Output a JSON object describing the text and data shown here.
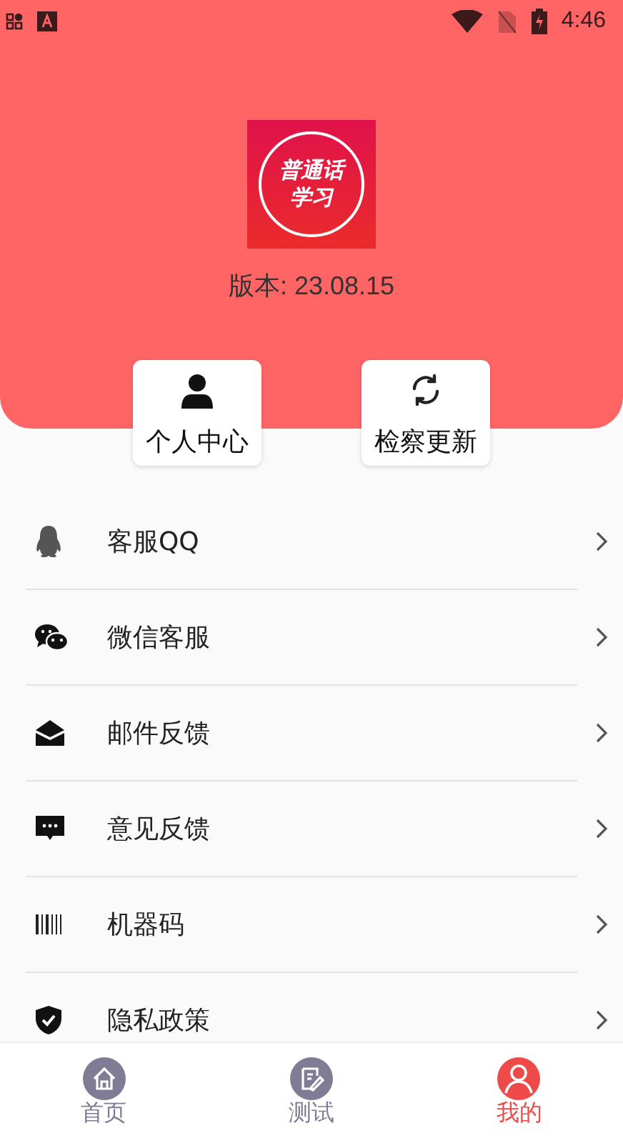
{
  "status_bar": {
    "time": "4:46"
  },
  "header": {
    "logo_text": [
      "普通话",
      "学习"
    ],
    "version": "版本: 23.08.15"
  },
  "actions": [
    {
      "kind": "person",
      "label": "个人中心"
    },
    {
      "kind": "refresh",
      "label": "检察更新"
    }
  ],
  "menu": [
    {
      "kind": "qq",
      "label": "客服QQ"
    },
    {
      "kind": "wechat",
      "label": "微信客服"
    },
    {
      "kind": "mail",
      "label": "邮件反馈"
    },
    {
      "kind": "message",
      "label": "意见反馈"
    },
    {
      "kind": "barcode",
      "label": "机器码"
    },
    {
      "kind": "shield",
      "label": "隐私政策"
    }
  ],
  "tabs": [
    {
      "kind": "home",
      "label": "首页",
      "selected": false
    },
    {
      "kind": "test",
      "label": "测试",
      "selected": false
    },
    {
      "kind": "me",
      "label": "我的",
      "selected": true
    }
  ]
}
